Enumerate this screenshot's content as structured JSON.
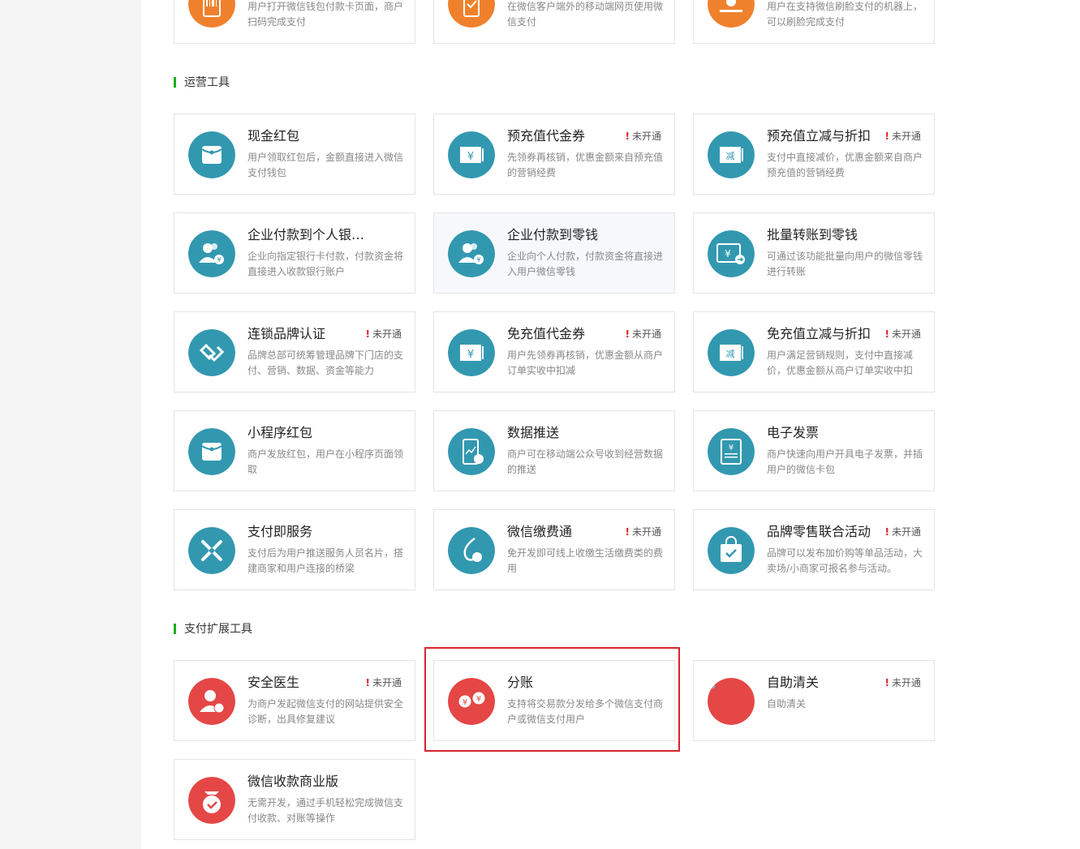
{
  "colors": {
    "accent_green": "#1aad19",
    "icon_orange": "#f0812c",
    "icon_teal": "#3298b0",
    "icon_red": "#e54646",
    "badge_red": "#e02020",
    "highlight_red": "#d9232d"
  },
  "top_row": [
    {
      "desc": "用户打开微信钱包付款卡页面，商户扫码完成支付",
      "icon": "phone-barcode-icon"
    },
    {
      "desc": "在微信客户端外的移动端网页使用微信支付",
      "icon": "mobile-check-icon"
    },
    {
      "desc": "用户在支持微信刷脸支付的机器上，可以刷脸完成支付",
      "icon": "face-pay-icon"
    }
  ],
  "sections": [
    {
      "title": "运营工具"
    },
    {
      "title": "支付扩展工具"
    }
  ],
  "badge_label": "未开通",
  "ops_cards": [
    {
      "title": "现金红包",
      "desc": "用户领取红包后，金额直接进入微信支付钱包",
      "badge": false,
      "icon": "red-packet-icon"
    },
    {
      "title": "预充值代金券",
      "desc": "先领券再核销，优惠金额来自预充值的营销经费",
      "badge": true,
      "icon": "yen-coupon-icon"
    },
    {
      "title": "预充值立减与折扣",
      "desc": "支付中直接减价，优惠金额来自商户预充值的营销经费",
      "badge": true,
      "icon": "discount-coupon-icon"
    },
    {
      "title": "企业付款到个人银…",
      "desc": "企业向指定银行卡付款，付款资金将直接进入收款银行账户",
      "badge": false,
      "icon": "users-yen-icon"
    },
    {
      "title": "企业付款到零钱",
      "desc": "企业向个人付款，付款资金将直接进入用户微信零钱",
      "badge": false,
      "icon": "users-yen-icon"
    },
    {
      "title": "批量转账到零钱",
      "desc": "可通过该功能批量向用户的微信零钱进行转账",
      "badge": false,
      "icon": "batch-transfer-icon"
    },
    {
      "title": "连锁品牌认证",
      "desc": "品牌总部可统筹管理品牌下门店的支付、营销、数据、资金等能力",
      "badge": true,
      "icon": "chain-link-icon"
    },
    {
      "title": "免充值代金券",
      "desc": "用户先领券再核销，优惠金额从商户订单实收中扣减",
      "badge": true,
      "icon": "yen-coupon-icon"
    },
    {
      "title": "免充值立减与折扣",
      "desc": "用户满足营销规则，支付中直接减价，优惠金额从商户订单实收中扣",
      "badge": true,
      "icon": "discount-coupon-icon"
    },
    {
      "title": "小程序红包",
      "desc": "商户发放红包，用户在小程序页面领取",
      "badge": false,
      "icon": "red-packet-icon"
    },
    {
      "title": "数据推送",
      "desc": "商户可在移动端公众号收到经营数据的推送",
      "badge": false,
      "icon": "data-push-icon"
    },
    {
      "title": "电子发票",
      "desc": "商户快速向用户开具电子发票，并插用户的微信卡包",
      "badge": false,
      "icon": "e-invoice-icon"
    },
    {
      "title": "支付即服务",
      "desc": "支付后为用户推送服务人员名片，搭建商家和用户连接的桥梁",
      "badge": false,
      "icon": "service-link-icon"
    },
    {
      "title": "微信缴费通",
      "desc": "免开发即可线上收缴生活缴费类的费用",
      "badge": true,
      "icon": "bill-pay-icon"
    },
    {
      "title": "品牌零售联合活动",
      "desc": "品牌可以发布加价购等单品活动，大卖场/小商家可报名参与活动。",
      "badge": true,
      "icon": "shopping-bag-icon"
    }
  ],
  "ext_cards": [
    {
      "title": "安全医生",
      "desc": "为商户发起微信支付的网站提供安全诊断，出具修复建议",
      "badge": true,
      "icon": "security-doctor-icon"
    },
    {
      "title": "分账",
      "desc": "支持将交易款分发给多个微信支付商户或微信支付用户",
      "badge": false,
      "icon": "split-payment-icon"
    },
    {
      "title": "自助清关",
      "desc": "自助清关",
      "badge": true,
      "icon": "customs-clearance-icon"
    },
    {
      "title": "微信收款商业版",
      "desc": "无需开发，通过手机轻松完成微信支付收款、对账等操作",
      "badge": false,
      "icon": "money-bag-icon"
    }
  ]
}
